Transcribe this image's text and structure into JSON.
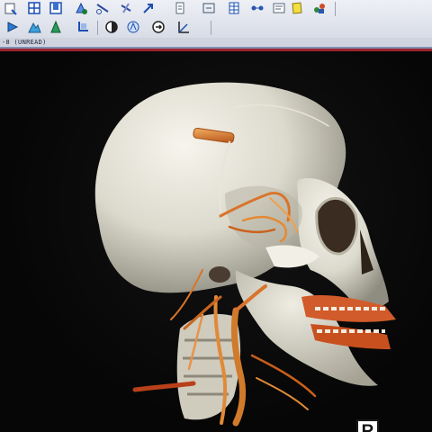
{
  "viewer": {
    "status": "-8 (UNREAD)",
    "orientation_marker": "R"
  },
  "toolbar": {
    "row1": [
      {
        "icon": "measure-icon"
      },
      {
        "icon": "layout-grid-icon"
      },
      {
        "icon": "single-view-icon"
      },
      {
        "icon": "volume-render-icon"
      },
      {
        "icon": "cut-tool-icon"
      },
      {
        "icon": "rotate-3d-icon"
      },
      {
        "icon": "arrow-tool-icon"
      },
      {
        "icon": "document-icon"
      },
      {
        "icon": "pan-icon"
      },
      {
        "icon": "grid-icon"
      },
      {
        "icon": "connect-icon"
      },
      {
        "icon": "report-icon"
      },
      {
        "icon": "export-icon"
      }
    ],
    "row2": [
      {
        "icon": "play-icon"
      },
      {
        "icon": "mountain-icon"
      },
      {
        "icon": "triangle-tool-icon"
      },
      {
        "icon": "crop-icon"
      },
      {
        "icon": "contrast-icon"
      },
      {
        "icon": "lighting-icon"
      },
      {
        "icon": "rotate-icon"
      },
      {
        "icon": "angle-icon"
      }
    ]
  },
  "colors": {
    "bone": "#e8e6dc",
    "vessel": "#c8661e",
    "vessel_bright": "#f0a04a",
    "accent_red": "#9c2430"
  }
}
